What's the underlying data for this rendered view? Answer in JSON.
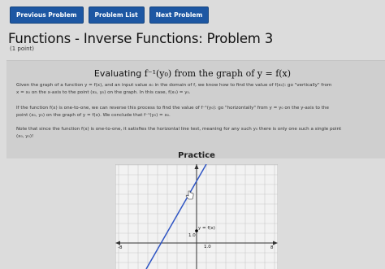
{
  "nav": {
    "previous": "Previous Problem",
    "list": "Problem List",
    "next": "Next Problem"
  },
  "title": "Functions - Inverse Functions: Problem 3",
  "points": "(1 point)",
  "heading": {
    "lead": "Evaluating ",
    "math": "f⁻¹(y₀) from the graph of y = f(x)"
  },
  "paragraphs": {
    "p1_a": "Given the graph of a function y = f(x), and an input value x₀ in the domain of f, we know how to find the value of f(x₀): go \"vertically\" from",
    "p1_b": "x = x₀ on the x-axis to the point (x₀, y₀) on the graph. In this case, f(x₀) = y₀.",
    "p2_a": "If the function f(x) is one-to-one, we can reverse this process to find the value of f⁻¹(y₀): go \"horizontally\" from y = y₀ on the y-axis to the",
    "p2_b": "point (x₀, y₀) on the graph of y = f(x). We conclude that f⁻¹(y₀) = x₀.",
    "p3_a": "Note that since the function f(x) is one-to-one, it satisfies the horizontal line test, meaning for any such y₀ there is only one such a single point",
    "p3_b": "(x₀, y₀)!"
  },
  "practice": "Practice",
  "graph": {
    "curve_label": "y = f(x)",
    "tick_y": "1.0",
    "tick_x": "1.0",
    "axis_left": "-8",
    "axis_right": "8",
    "line_color": "#2f55c4"
  },
  "colors": {
    "nav_button": "#1d57a3",
    "highlight": "#1a5bb5",
    "background": "#dcdcdc"
  }
}
